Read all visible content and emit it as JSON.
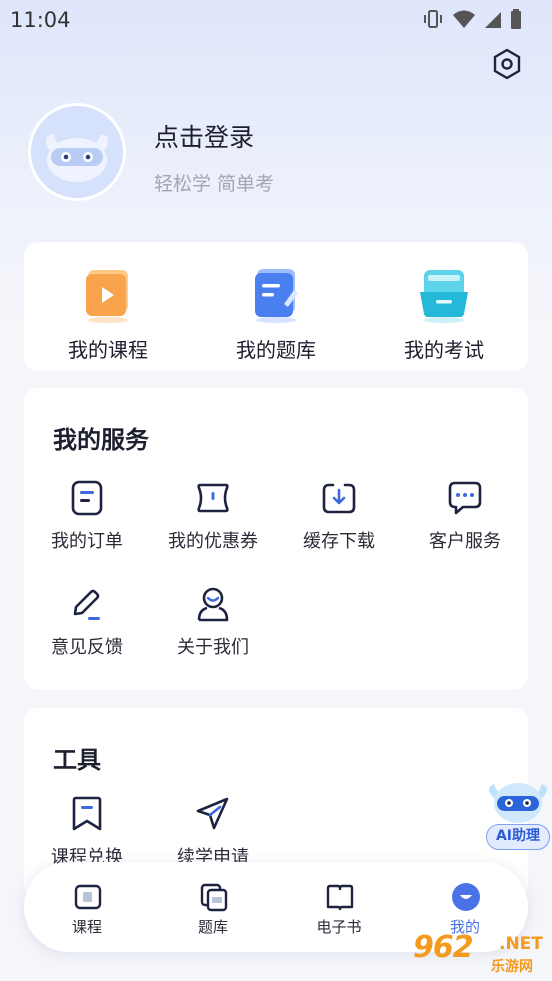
{
  "status_bar": {
    "time": "11:04"
  },
  "profile": {
    "login_text": "点击登录",
    "slogan": "轻松学 简单考"
  },
  "quick_links": [
    {
      "label": "我的课程",
      "icon": "course-video-icon"
    },
    {
      "label": "我的题库",
      "icon": "question-bank-icon"
    },
    {
      "label": "我的考试",
      "icon": "exam-icon"
    }
  ],
  "services": {
    "title": "我的服务",
    "items": [
      {
        "label": "我的订单",
        "icon": "order-icon"
      },
      {
        "label": "我的优惠券",
        "icon": "coupon-icon"
      },
      {
        "label": "缓存下载",
        "icon": "download-icon"
      },
      {
        "label": "客户服务",
        "icon": "chat-icon"
      },
      {
        "label": "意见反馈",
        "icon": "pencil-icon"
      },
      {
        "label": "关于我们",
        "icon": "user-icon"
      }
    ]
  },
  "tools": {
    "title": "工具",
    "items": [
      {
        "label": "课程兑换",
        "icon": "bookmark-icon"
      },
      {
        "label": "续学申请",
        "icon": "send-icon"
      }
    ]
  },
  "ai_assistant": {
    "label": "AI助理"
  },
  "tabbar": {
    "tabs": [
      {
        "label": "课程",
        "icon": "course-tab-icon"
      },
      {
        "label": "题库",
        "icon": "bank-tab-icon"
      },
      {
        "label": "电子书",
        "icon": "ebook-tab-icon"
      },
      {
        "label": "我的",
        "icon": "profile-tab-icon"
      }
    ],
    "active_index": 3
  },
  "watermark": {
    "number": "962",
    "suffix": ".NET",
    "site": "乐游网"
  },
  "colors": {
    "accent": "#4a72e6",
    "text_primary": "#1d1f2e",
    "text_secondary": "#a3a7b3",
    "icon_stroke": "#1d2340",
    "icon_accent": "#3d6ae0",
    "background": "#f5f6fa"
  }
}
